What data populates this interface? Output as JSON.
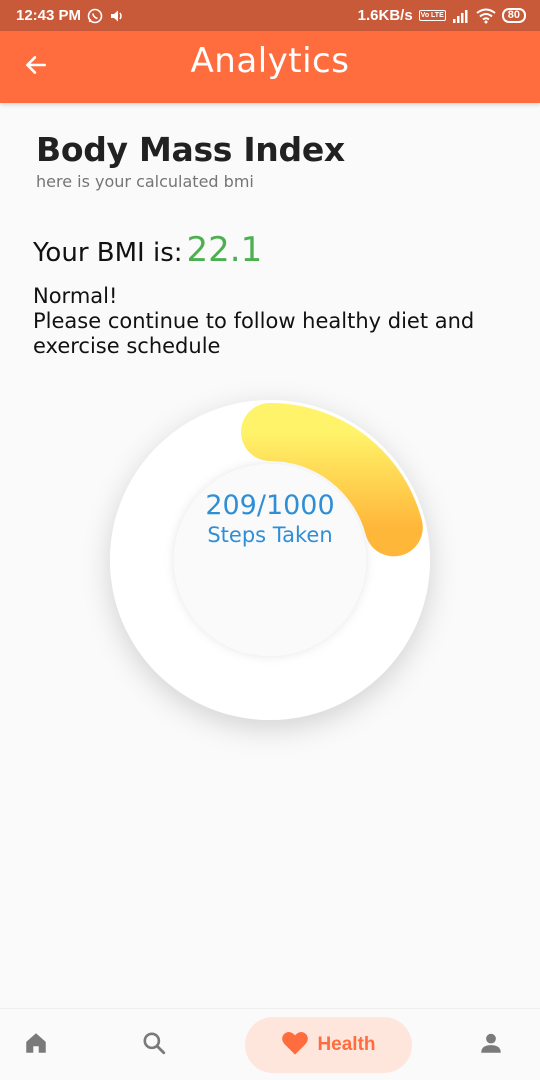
{
  "status_bar": {
    "time": "12:43 PM",
    "network_speed": "1.6KB/s",
    "volte": "Vo LTE",
    "battery": "80",
    "icons": [
      "whatsapp-icon",
      "volume-icon",
      "signal-icon",
      "wifi-icon",
      "battery-icon"
    ]
  },
  "app_bar": {
    "title": "Analytics",
    "back_icon": "arrow-left-icon",
    "color": "#ff6d3f"
  },
  "content": {
    "heading": "Body Mass Index",
    "subheading": "here is your calculated bmi",
    "bmi_label": "Your BMI is:",
    "bmi_value": "22.1",
    "bmi_value_color": "#4caf50",
    "status_line1": "Normal!",
    "status_line2": "Please continue to follow healthy diet and exercise schedule"
  },
  "steps": {
    "display": "209/1000",
    "label": "Steps Taken",
    "taken": 209,
    "goal": 1000,
    "text_color": "#2f8fd6",
    "gradient_start": "#fff36a",
    "gradient_end": "#ffb73a"
  },
  "bottom_nav": {
    "items": [
      {
        "icon": "home-icon",
        "label": "",
        "active": false
      },
      {
        "icon": "search-icon",
        "label": "",
        "active": false
      },
      {
        "icon": "heart-icon",
        "label": "Health",
        "active": true
      },
      {
        "icon": "person-icon",
        "label": "",
        "active": false
      }
    ],
    "active_color": "#ff6d3f",
    "active_bg": "#ffe6dd",
    "inactive_color": "#7a7a7a"
  }
}
